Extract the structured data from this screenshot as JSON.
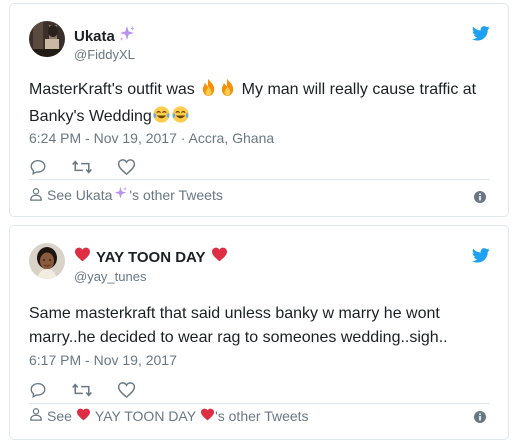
{
  "tweets": [
    {
      "display_name": "Ukata",
      "handle": "@FiddyXL",
      "text_a": "MasterKraft's outfit was ",
      "text_b": " My man will really cause traffic at Banky's Wedding",
      "timestamp": "6:24 PM - Nov 19, 2017",
      "location": "· Accra, Ghana",
      "see_prefix": "See Ukata",
      "see_suffix": "'s other Tweets"
    },
    {
      "display_name": "YAY TOON DAY",
      "handle": "@yay_tunes",
      "text": "Same masterkraft that said unless banky w marry he wont marry..he decided to wear rag to someones wedding..sigh..",
      "timestamp": "6:17 PM - Nov 19, 2017",
      "see_prefix": "See",
      "see_name": "YAY TOON DAY",
      "see_suffix": "'s other Tweets"
    }
  ],
  "icons": {
    "brand": "twitter-bird-icon",
    "reply": "reply-icon",
    "retweet": "retweet-icon",
    "like": "heart-icon",
    "person": "person-icon",
    "info": "info-icon",
    "sparkles": "sparkles-emoji",
    "fire": "fire-emoji",
    "laugh": "tears-of-joy-emoji",
    "red_heart": "red-heart-emoji"
  },
  "colors": {
    "brand_blue": "#1da1f2",
    "text": "#1c2022",
    "muted": "#697882",
    "border": "#e1e8ed",
    "heart_red": "#e0245e"
  }
}
